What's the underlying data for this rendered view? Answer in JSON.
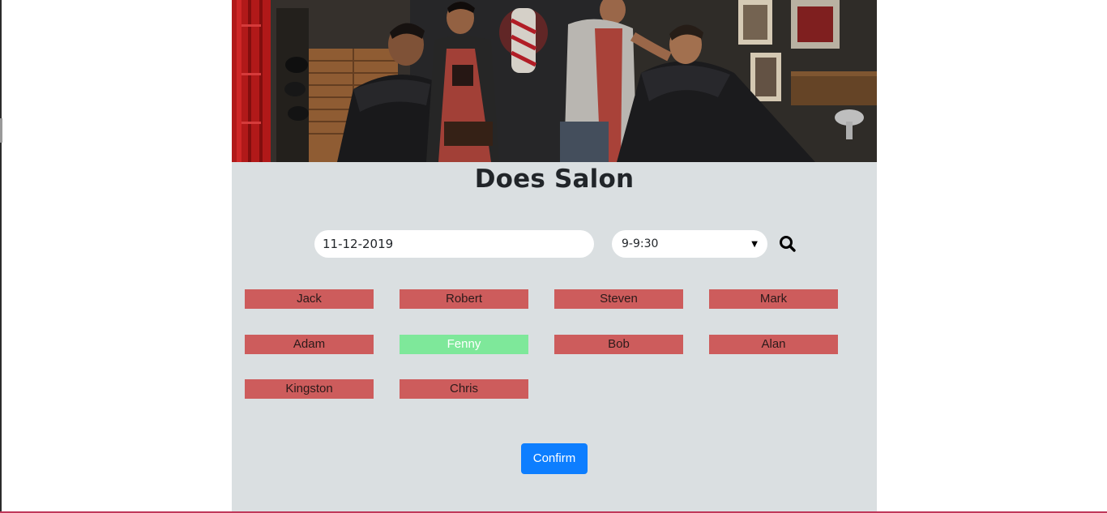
{
  "app": {
    "title": "Does Salon"
  },
  "booking": {
    "date_value": "11-12-2019",
    "time_selected": "9-9:30",
    "search_icon": "search-icon"
  },
  "stylists": [
    {
      "name": "Jack",
      "selected": false
    },
    {
      "name": "Robert",
      "selected": false
    },
    {
      "name": "Steven",
      "selected": false
    },
    {
      "name": "Mark",
      "selected": false
    },
    {
      "name": "Adam",
      "selected": false
    },
    {
      "name": "Fenny",
      "selected": true
    },
    {
      "name": "Bob",
      "selected": false
    },
    {
      "name": "Alan",
      "selected": false
    },
    {
      "name": "Kingston",
      "selected": false
    },
    {
      "name": "Chris",
      "selected": false
    }
  ],
  "actions": {
    "confirm_label": "Confirm"
  },
  "colors": {
    "background_panel": "#dadfe1",
    "stylist_unavailable": "#cd5c5c",
    "stylist_selected": "#7ee89a",
    "primary": "#0d7eff"
  }
}
